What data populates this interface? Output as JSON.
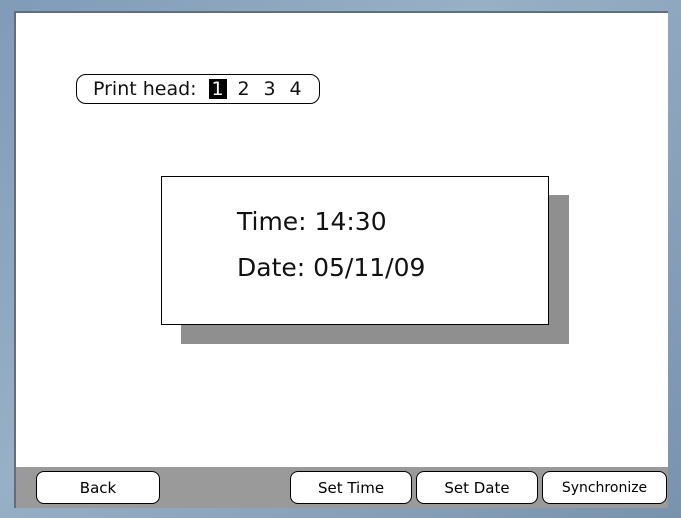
{
  "print_head": {
    "label": "Print head:",
    "heads": [
      "1",
      "2",
      "3",
      "4"
    ],
    "selected": "1"
  },
  "clock": {
    "time_line": "Time: 14:30",
    "date_line": "Date: 05/11/09"
  },
  "softkeys": {
    "back": "Back",
    "set_time": "Set Time",
    "set_date": "Set Date",
    "synchronize": "Synchronize"
  }
}
